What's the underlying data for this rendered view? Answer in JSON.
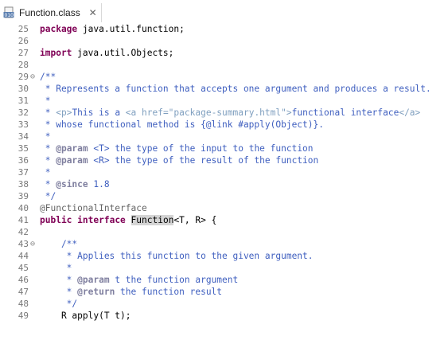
{
  "tab": {
    "icon": "class-file-icon",
    "title": "Function.class",
    "close_icon": "close-icon",
    "close_glyph": "✕"
  },
  "editor": {
    "lines": [
      {
        "num": "25",
        "fold": "",
        "tokens": [
          {
            "t": "package",
            "c": "kw"
          },
          {
            "t": " java.util.function;",
            "c": "plain"
          }
        ]
      },
      {
        "num": "26",
        "fold": "",
        "tokens": []
      },
      {
        "num": "27",
        "fold": "",
        "tokens": [
          {
            "t": "import",
            "c": "kw"
          },
          {
            "t": " java.util.Objects;",
            "c": "plain"
          }
        ]
      },
      {
        "num": "28",
        "fold": "",
        "tokens": []
      },
      {
        "num": "29",
        "fold": "⊖",
        "tokens": [
          {
            "t": "/**",
            "c": "jd"
          }
        ]
      },
      {
        "num": "30",
        "fold": "",
        "tokens": [
          {
            "t": " * Represents a function that accepts one argument and produces a result.",
            "c": "jd"
          }
        ]
      },
      {
        "num": "31",
        "fold": "",
        "tokens": [
          {
            "t": " *",
            "c": "jd"
          }
        ]
      },
      {
        "num": "32",
        "fold": "",
        "tokens": [
          {
            "t": " * ",
            "c": "jd"
          },
          {
            "t": "<p>",
            "c": "jdtag"
          },
          {
            "t": "This is a ",
            "c": "jd"
          },
          {
            "t": "<a href=\"package-summary.html\">",
            "c": "jdtag"
          },
          {
            "t": "functional interface",
            "c": "jd"
          },
          {
            "t": "</a>",
            "c": "jdtag"
          }
        ]
      },
      {
        "num": "33",
        "fold": "",
        "tokens": [
          {
            "t": " * whose functional method is {@link #apply(Object)}.",
            "c": "jd"
          }
        ]
      },
      {
        "num": "34",
        "fold": "",
        "tokens": [
          {
            "t": " *",
            "c": "jd"
          }
        ]
      },
      {
        "num": "35",
        "fold": "",
        "tokens": [
          {
            "t": " * ",
            "c": "jd"
          },
          {
            "t": "@param",
            "c": "jdkw"
          },
          {
            "t": " <T> the type of the input to the function",
            "c": "jd"
          }
        ]
      },
      {
        "num": "36",
        "fold": "",
        "tokens": [
          {
            "t": " * ",
            "c": "jd"
          },
          {
            "t": "@param",
            "c": "jdkw"
          },
          {
            "t": " <R> the type of the result of the function",
            "c": "jd"
          }
        ]
      },
      {
        "num": "37",
        "fold": "",
        "tokens": [
          {
            "t": " *",
            "c": "jd"
          }
        ]
      },
      {
        "num": "38",
        "fold": "",
        "tokens": [
          {
            "t": " * ",
            "c": "jd"
          },
          {
            "t": "@since",
            "c": "jdkw"
          },
          {
            "t": " 1.8",
            "c": "jd"
          }
        ]
      },
      {
        "num": "39",
        "fold": "",
        "tokens": [
          {
            "t": " */",
            "c": "jd"
          }
        ]
      },
      {
        "num": "40",
        "fold": "",
        "tokens": [
          {
            "t": "@FunctionalInterface",
            "c": "ann"
          }
        ]
      },
      {
        "num": "41",
        "fold": "",
        "tokens": [
          {
            "t": "public",
            "c": "kw"
          },
          {
            "t": " ",
            "c": "plain"
          },
          {
            "t": "interface",
            "c": "kw"
          },
          {
            "t": " ",
            "c": "plain"
          },
          {
            "t": "Function",
            "c": "plain hl"
          },
          {
            "t": "<T, R> {",
            "c": "plain"
          }
        ]
      },
      {
        "num": "42",
        "fold": "",
        "tokens": []
      },
      {
        "num": "43",
        "fold": "⊖",
        "tokens": [
          {
            "t": "    /**",
            "c": "jd"
          }
        ]
      },
      {
        "num": "44",
        "fold": "",
        "tokens": [
          {
            "t": "     * Applies this function to the given argument.",
            "c": "jd"
          }
        ]
      },
      {
        "num": "45",
        "fold": "",
        "tokens": [
          {
            "t": "     *",
            "c": "jd"
          }
        ]
      },
      {
        "num": "46",
        "fold": "",
        "tokens": [
          {
            "t": "     * ",
            "c": "jd"
          },
          {
            "t": "@param",
            "c": "jdkw"
          },
          {
            "t": " t the function argument",
            "c": "jd"
          }
        ]
      },
      {
        "num": "47",
        "fold": "",
        "tokens": [
          {
            "t": "     * ",
            "c": "jd"
          },
          {
            "t": "@return",
            "c": "jdkw"
          },
          {
            "t": " the function result",
            "c": "jd"
          }
        ]
      },
      {
        "num": "48",
        "fold": "",
        "tokens": [
          {
            "t": "     */",
            "c": "jd"
          }
        ]
      },
      {
        "num": "49",
        "fold": "",
        "tokens": [
          {
            "t": "    R apply(T t);",
            "c": "plain"
          }
        ]
      }
    ]
  }
}
